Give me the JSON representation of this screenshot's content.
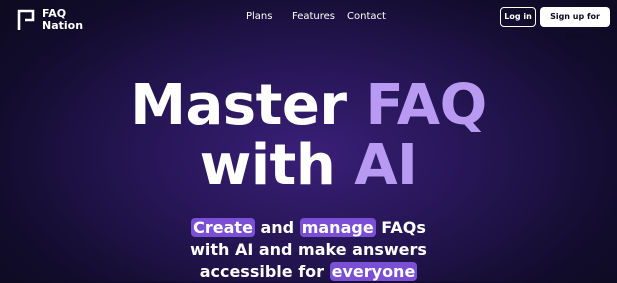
{
  "brand": {
    "line1": "FAQ",
    "line2": "Nation"
  },
  "nav": {
    "plans": "Plans",
    "features": "Features",
    "contact": "Contact"
  },
  "auth": {
    "login": "Log in",
    "signup": "Sign up for free"
  },
  "hero": {
    "title_part1": "Master ",
    "title_accent1": "FAQ",
    "title_part2": "with ",
    "title_accent2": "AI",
    "sub_hl1": "Create",
    "sub_text1": " and ",
    "sub_hl2": "manage",
    "sub_text2": " FAQs",
    "sub_line2": "with AI and make answers",
    "sub_text3": "accessible for ",
    "sub_hl3": "everyone"
  },
  "colors": {
    "background": "#1c1240",
    "accent": "#b89af2",
    "highlight": "#7a4fd6"
  }
}
